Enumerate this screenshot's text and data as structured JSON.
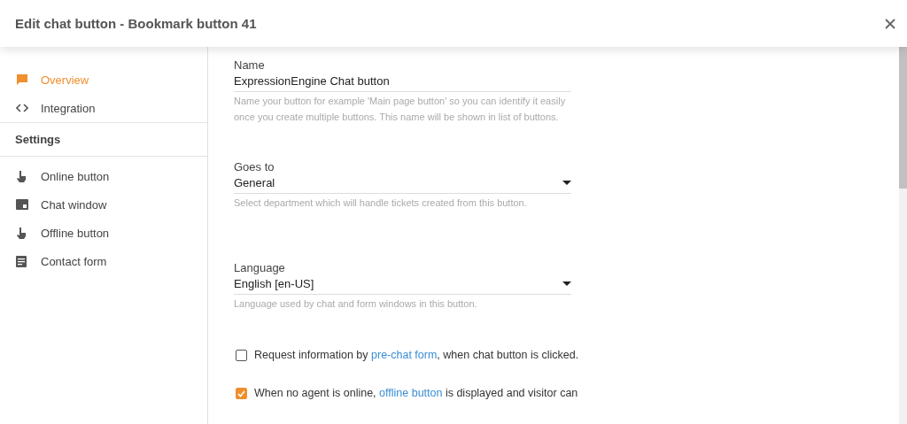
{
  "dialog": {
    "title": "Edit chat button - Bookmark button 41"
  },
  "sidebar": {
    "items": [
      {
        "label": "Overview",
        "selected": true
      },
      {
        "label": "Integration",
        "selected": false
      }
    ],
    "section": "Settings",
    "settings_items": [
      {
        "label": "Online button",
        "selected": false
      },
      {
        "label": "Chat window",
        "selected": false
      },
      {
        "label": "Offline button",
        "selected": false
      },
      {
        "label": "Contact form",
        "selected": false
      }
    ]
  },
  "form": {
    "fields": [
      {
        "kind": "text",
        "label": "Name",
        "value": "ExpressionEngine Chat button",
        "help": "Name your button for example 'Main page button' so you can identify it easily once you create multiple buttons. This name will be shown in list of buttons."
      },
      {
        "kind": "select",
        "label": "Goes to",
        "value": "General",
        "help": "Select department which will handle tickets created from this button."
      },
      {
        "kind": "select",
        "label": "Language",
        "value": "English [en-US]",
        "help": "Language used by chat and form windows in this button."
      }
    ],
    "options": [
      {
        "checked": false,
        "parts": [
          {
            "kind": "text",
            "text": "Request information by "
          },
          {
            "kind": "link",
            "text": "pre-chat form"
          },
          {
            "kind": "text",
            "text": ", when chat button is clicked."
          }
        ]
      },
      {
        "checked": true,
        "parts": [
          {
            "kind": "text",
            "text": "When no agent is online, "
          },
          {
            "kind": "link",
            "text": "offline button"
          },
          {
            "kind": "text",
            "text": " is displayed and visitor can"
          }
        ]
      }
    ]
  }
}
